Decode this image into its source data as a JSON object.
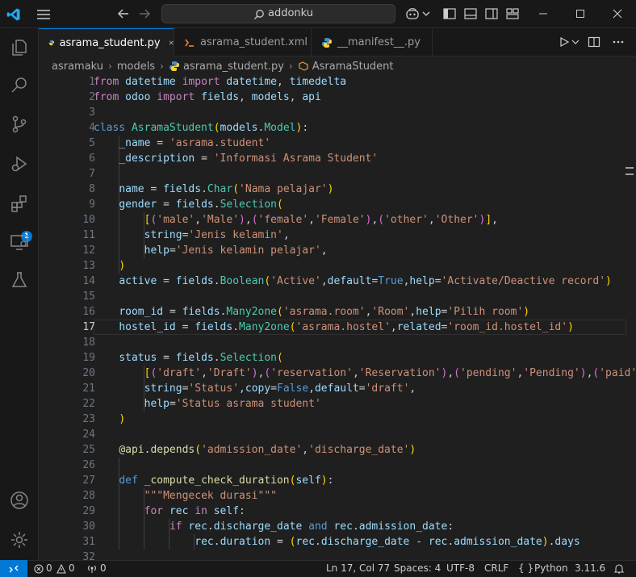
{
  "titlebar": {
    "search_text": "addonku"
  },
  "tabs": [
    {
      "label": "asrama_student.py",
      "active": true,
      "icon": "python-icon"
    },
    {
      "label": "asrama_student.xml",
      "active": false,
      "icon": "xml-icon"
    },
    {
      "label": "__manifest__.py",
      "active": false,
      "icon": "python-icon"
    }
  ],
  "breadcrumb": {
    "items": [
      "asramaku",
      "models",
      "asrama_student.py",
      "AsramaStudent"
    ]
  },
  "activity": {
    "extensions_badge": "1"
  },
  "editor": {
    "current_line": 17,
    "line_numbers": [
      "1",
      "2",
      "3",
      "4",
      "5",
      "6",
      "7",
      "8",
      "9",
      "10",
      "11",
      "12",
      "13",
      "14",
      "15",
      "16",
      "17",
      "18",
      "19",
      "20",
      "21",
      "22",
      "23",
      "24",
      "25",
      "26",
      "27",
      "28",
      "29",
      "30",
      "31",
      "32"
    ],
    "lines": [
      "from datetime import datetime, timedelta",
      "from odoo import fields, models, api",
      "",
      "class AsramaStudent(models.Model):",
      "    _name = 'asrama.student'",
      "    _description = 'Informasi Asrama Student'",
      "",
      "    name = fields.Char('Nama pelajar')",
      "    gender = fields.Selection(",
      "        [('male','Male'),('female','Female'),('other','Other')],",
      "        string='Jenis kelamin',",
      "        help='Jenis kelamin pelajar',",
      "    )",
      "    active = fields.Boolean('Active',default=True,help='Activate/Deactive record')",
      "",
      "    room_id = fields.Many2one('asrama.room','Room',help='Pilih room')",
      "    hostel_id = fields.Many2one('asrama.hostel',related='room_id.hostel_id')",
      "",
      "    status = fields.Selection(",
      "        [('draft','Draft'),('reservation','Reservation'),('pending','Pending'),('paid',",
      "        string='Status',copy=False,default='draft',",
      "        help='Status asrama student'",
      "    )",
      "",
      "    @api.depends('admission_date','discharge_date')",
      "",
      "    def _compute_check_duration(self):",
      "        \"\"\"Mengecek durasi\"\"\"",
      "        for rec in self:",
      "            if rec.discharge_date and rec.admission_date:",
      "                rec.duration = (rec.discharge_date - rec.admission_date).days",
      ""
    ]
  },
  "statusbar": {
    "errors": "0",
    "warnings": "0",
    "ports": "0",
    "position": "Ln 17, Col 77",
    "spaces": "Spaces: 4",
    "encoding": "UTF-8",
    "eol": "CRLF",
    "language": "Python",
    "version": "3.11.6"
  },
  "colors": {
    "accent": "#0078d4",
    "keyword": "#c586c0",
    "storage": "#569cd6",
    "class": "#4ec9b0",
    "function": "#dcdcaa",
    "variable": "#9cdcfe",
    "string": "#ce9178"
  }
}
